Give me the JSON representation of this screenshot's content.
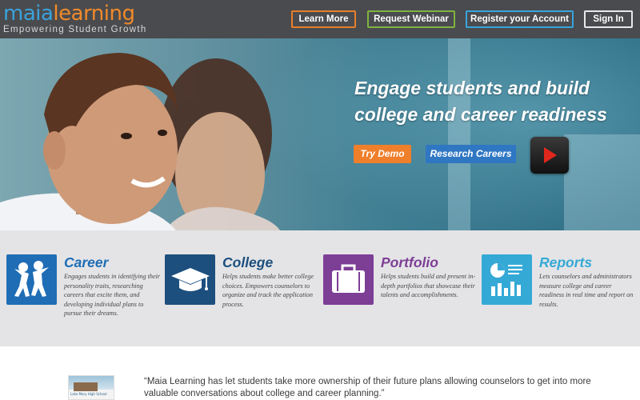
{
  "brand": {
    "logo_part1": "maia",
    "logo_part2": "learning",
    "tagline": "Empowering Student Growth"
  },
  "nav": {
    "learn_more": "Learn More",
    "request_webinar": "Request Webinar",
    "register": "Register your Account",
    "sign_in": "Sign In"
  },
  "hero": {
    "headline": "Engage students and build college and career readiness",
    "try_demo": "Try Demo",
    "research_careers": "Research Careers"
  },
  "features": [
    {
      "title": "Career",
      "icon": "people-icon",
      "color": "#1f6db5",
      "description": "Engages students in identifying their personality traits, researching careers that excite them, and developing individual plans to pursue their dreams."
    },
    {
      "title": "College",
      "icon": "graduation-cap-icon",
      "color": "#1c4f7e",
      "description": "Helps students make better college choices. Empowers counselors to organize and track the application process."
    },
    {
      "title": "Portfolio",
      "icon": "briefcase-icon",
      "color": "#7d3e96",
      "description": "Helps students build and present in-depth portfolios that showcase their talents and accomplishments."
    },
    {
      "title": "Reports",
      "icon": "chart-report-icon",
      "color": "#35a9d6",
      "description": "Lets counselors and administrators measure college and career readiness in real time and report on results."
    }
  ],
  "testimonial": {
    "quote": "“Maia Learning has let students take more ownership of their future plans allowing counselors to get into more valuable conversations about college and career planning.”",
    "thumbnail_caption": "Lake Mary High School"
  }
}
